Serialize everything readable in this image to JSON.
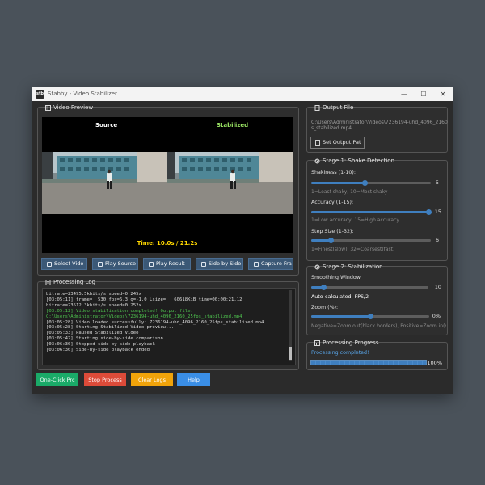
{
  "window": {
    "app_icon": "stb",
    "title": "Stabby - Video Stabilizer",
    "minimize": "—",
    "maximize": "☐",
    "close": "✕"
  },
  "preview": {
    "header": "Video Preview",
    "icon": "film-icon",
    "source_label": "Source",
    "stabilized_label": "Stabilized",
    "source_color": "#ffffff",
    "stabilized_color": "#9be564",
    "time": "Time: 10.0s / 21.2s",
    "time_color": "#ffd700"
  },
  "controls": [
    {
      "label": "Select Vide",
      "icon": "folder-icon"
    },
    {
      "label": "Play Source",
      "icon": "play-icon"
    },
    {
      "label": "Play Result",
      "icon": "play-icon"
    },
    {
      "label": "Side by Side",
      "icon": "compare-icon"
    },
    {
      "label": "Capture Fra",
      "icon": "camera-icon"
    }
  ],
  "log": {
    "header": "Processing Log",
    "icon": "document-icon",
    "lines": [
      {
        "text": "bitrate=23495.5kbits/s speed=0.245x",
        "green": false
      },
      {
        "text": "[03:05:11] frame=  530 fps=6.3 q=-1.0 Lsize=   60618KiB time=00:00:21.12",
        "green": false
      },
      {
        "text": "bitrate=23512.3kbits/s speed=0.252x",
        "green": false
      },
      {
        "text": "[03:05:12] Video stabilization completed! Output file:",
        "green": true
      },
      {
        "text": "C:\\Users\\Administrator\\Videos\\7236194-uhd_4096_2160_25fps_stabilized.mp4",
        "green": true
      },
      {
        "text": "[03:05:28] Video loaded successfully: 7236194-uhd_4096_2160_25fps_stabilized.mp4",
        "green": false
      },
      {
        "text": "[03:05:28] Starting Stabilized Video preview...",
        "green": false
      },
      {
        "text": "[03:05:33] Paused Stabilized Video",
        "green": false
      },
      {
        "text": "[03:05:47] Starting side-by-side comparison...",
        "green": false
      },
      {
        "text": "[03:06:30] Stopped side-by-side playback",
        "green": false
      },
      {
        "text": "[03:06:30] Side-by-side playback ended",
        "green": false
      }
    ]
  },
  "actions": [
    {
      "label": "One-Click Prc",
      "color": "#1aaa68"
    },
    {
      "label": "Stop Process",
      "color": "#dd4b39"
    },
    {
      "label": "Clear Logs",
      "color": "#f0a30a"
    },
    {
      "label": "Help",
      "color": "#3a8ee6"
    }
  ],
  "output": {
    "header": "Output File",
    "icon": "document-icon",
    "path_line1": "C:\\Users\\Administrator\\Videos\\7236194-uhd_4096_2160",
    "path_line2": "s_stabilized.mp4",
    "button": "Set Output Pat",
    "button_icon": "document-icon"
  },
  "stage1": {
    "header": "Stage 1: Shake Detection",
    "icon": "gear-icon",
    "shakiness_label": "Shakiness (1-10):",
    "shakiness_value": "5",
    "shakiness_fraction": 0.444,
    "shakiness_hint": "1=Least shaky, 10=Most shaky",
    "accuracy_label": "Accuracy (1-15):",
    "accuracy_value": "15",
    "accuracy_fraction": 1.0,
    "accuracy_hint": "1=Low accuracy, 15=High accuracy",
    "step_label": "Step Size (1-32):",
    "step_value": "6",
    "step_fraction": 0.161,
    "step_hint": "1=Finest(slow), 32=Coarsest(fast)"
  },
  "stage2": {
    "header": "Stage 2: Stabilization",
    "icon": "gear-icon",
    "smoothing_label": "Smoothing Window:",
    "smoothing_value": "10",
    "smoothing_fraction": 0.1,
    "auto_calc": "Auto-calculated: FPS/2",
    "zoom_label": "Zoom (%):",
    "zoom_value": "0%",
    "zoom_fraction": 0.5,
    "zoom_hint": "Negative=Zoom out(black borders), Positive=Zoom in(crop"
  },
  "progress": {
    "header": "Processing Progress",
    "icon": "gauge-icon",
    "status": "Processing completed!",
    "status_color": "#5aaaf0",
    "value": 100,
    "label": "100%",
    "bar_color": "#3f7fbf"
  }
}
